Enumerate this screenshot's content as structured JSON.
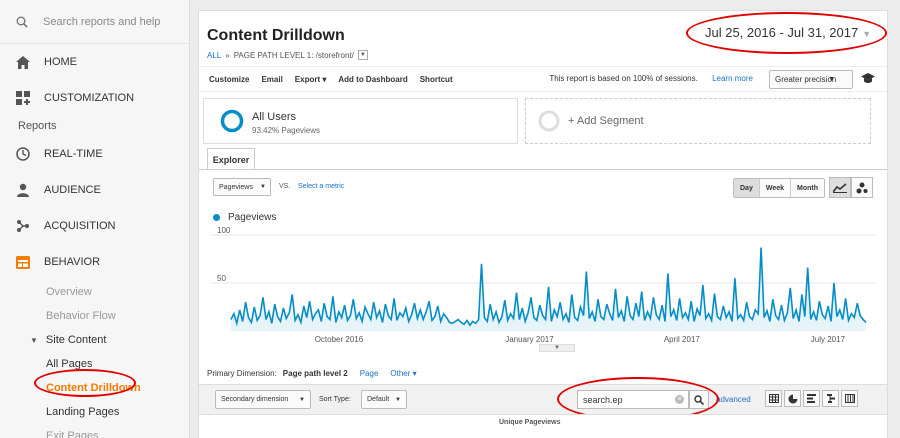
{
  "sidebar": {
    "search_placeholder": "Search reports and help",
    "items": [
      {
        "label": "HOME",
        "icon": "home-icon"
      },
      {
        "label": "CUSTOMIZATION",
        "icon": "grid-plus-icon"
      }
    ],
    "reports_label": "Reports",
    "report_items": [
      {
        "label": "REAL-TIME",
        "icon": "clock-icon"
      },
      {
        "label": "AUDIENCE",
        "icon": "person-icon"
      },
      {
        "label": "ACQUISITION",
        "icon": "share-icon"
      },
      {
        "label": "BEHAVIOR",
        "icon": "behavior-icon"
      }
    ],
    "behavior_sub": {
      "overview": "Overview",
      "behavior_flow": "Behavior Flow",
      "site_content": "Site Content",
      "all_pages": "All Pages",
      "content_drilldown": "Content Drilldown",
      "landing_pages": "Landing Pages",
      "exit_pages": "Exit Pages"
    },
    "accent_color": "#f57c00"
  },
  "header": {
    "title": "Content Drilldown",
    "crumb_all": "ALL",
    "crumb_sep": "»",
    "crumb_path": "PAGE PATH LEVEL 1: /storefront/",
    "date_range": "Jul 25, 2016 - Jul 31, 2017"
  },
  "toolbar": {
    "customize": "Customize",
    "email": "Email",
    "export": "Export ▾",
    "add_to_dashboard": "Add to Dashboard",
    "shortcut": "Shortcut",
    "sampling_text": "This report is based on 100% of sessions.",
    "learn_more": "Learn more",
    "precision": "Greater precision"
  },
  "segments": {
    "active_name": "All Users",
    "active_sub": "93.42% Pageviews",
    "add_label": "+ Add Segment"
  },
  "explorer": {
    "tab": "Explorer",
    "metric": "Pageviews",
    "vs": "VS.",
    "select_metric": "Select a metric",
    "periods": [
      "Day",
      "Week",
      "Month"
    ],
    "active_period": "Day"
  },
  "chart_data": {
    "type": "line",
    "series": [
      {
        "name": "Pageviews",
        "color": "#058dc7",
        "values": [
          12,
          18,
          8,
          22,
          10,
          30,
          14,
          9,
          25,
          11,
          16,
          35,
          12,
          20,
          8,
          28,
          15,
          10,
          24,
          13,
          19,
          38,
          11,
          17,
          9,
          26,
          14,
          31,
          12,
          18,
          22,
          10,
          29,
          15,
          12,
          36,
          9,
          20,
          14,
          27,
          11,
          16,
          33,
          13,
          19,
          10,
          25,
          18,
          12,
          30,
          14,
          21,
          9,
          28,
          16,
          12,
          34,
          11,
          19,
          15,
          24,
          10,
          17,
          29,
          13,
          22,
          12,
          20,
          31,
          11,
          15,
          26,
          10,
          18,
          14,
          9,
          8,
          10,
          12,
          9,
          7,
          11,
          6,
          10,
          8,
          12,
          70,
          14,
          10,
          28,
          12,
          20,
          9,
          15,
          32,
          11,
          18,
          13,
          40,
          12,
          24,
          10,
          19,
          35,
          14,
          11,
          27,
          16,
          12,
          46,
          10,
          22,
          15,
          30,
          12,
          18,
          9,
          38,
          14,
          11,
          25,
          16,
          62,
          13,
          20,
          10,
          33,
          15,
          12,
          28,
          18,
          11,
          44,
          14,
          21,
          10,
          36,
          16,
          12,
          29,
          15,
          41,
          11,
          20,
          13,
          35,
          17,
          12,
          27,
          10,
          60,
          15,
          22,
          11,
          34,
          14,
          19,
          12,
          31,
          10,
          23,
          16,
          48,
          13,
          18,
          11,
          39,
          15,
          12,
          26,
          14,
          20,
          10,
          55,
          13,
          17,
          11,
          30,
          15,
          12,
          22,
          18,
          87,
          14,
          21,
          10,
          33,
          16,
          12,
          27,
          11,
          19,
          45,
          13,
          22,
          10,
          38,
          15,
          66,
          12,
          20,
          11,
          31,
          17,
          13,
          26,
          10,
          50,
          15,
          22,
          12,
          34,
          11,
          18,
          14,
          29,
          16,
          12,
          9
        ]
      }
    ],
    "ylabel_ticks": [
      "100",
      "50"
    ],
    "x_ticks": [
      "October 2016",
      "January 2017",
      "April 2017",
      "July 2017"
    ],
    "ylim": [
      0,
      100
    ]
  },
  "table_controls": {
    "primary_dim_label": "Primary Dimension:",
    "primary_dim_value": "Page path level 2",
    "page_link": "Page",
    "other_link": "Other ▾",
    "secondary_dim": "Secondary dimension",
    "sort_type_label": "Sort Type:",
    "sort_type_value": "Default",
    "filter_value": "search.ep",
    "advanced": "advanced",
    "col_unique_pageviews": "Unique Pageviews"
  },
  "colors": {
    "highlight": "#e00000",
    "link": "#1a73c8"
  }
}
